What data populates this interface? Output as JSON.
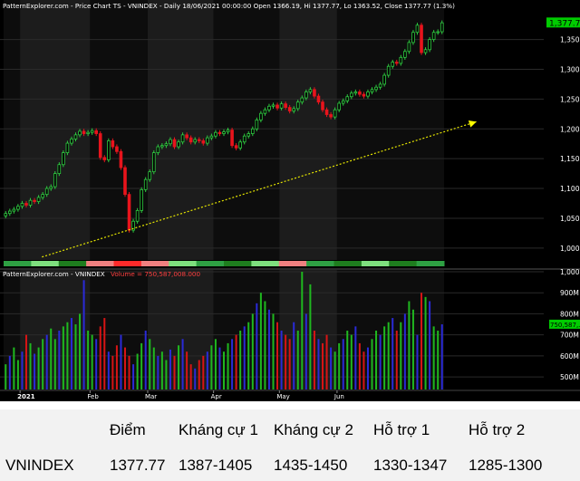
{
  "chart_data": [
    {
      "type": "candlestick",
      "header": "PatternExplorer.com - Price Chart TS - VNINDEX - Daily 18/06/2021 00:00:00 Open 1366.19, Hi 1377.77, Lo 1363.52, Close 1377.77 (1.3%)",
      "symbol": "VNINDEX",
      "last": {
        "open": 1366.19,
        "high": 1377.77,
        "low": 1363.52,
        "close": 1377.77,
        "change_pct": 1.3
      },
      "price_badge": "1,377.77",
      "ylim": [
        980,
        1395
      ],
      "yticks": [
        1000,
        1050,
        1100,
        1150,
        1200,
        1250,
        1300,
        1350
      ],
      "ytick_labels": [
        "1,000",
        "1,050",
        "1,100",
        "1,150",
        "1,200",
        "1,250",
        "1,300",
        "1,350"
      ],
      "closes": [
        1058,
        1062,
        1065,
        1070,
        1075,
        1072,
        1080,
        1078,
        1085,
        1090,
        1100,
        1103,
        1125,
        1140,
        1160,
        1176,
        1183,
        1190,
        1196,
        1192,
        1194,
        1197,
        1192,
        1152,
        1148,
        1180,
        1170,
        1162,
        1135,
        1090,
        1030,
        1045,
        1063,
        1098,
        1115,
        1128,
        1160,
        1170,
        1172,
        1175,
        1182,
        1170,
        1178,
        1190,
        1185,
        1178,
        1182,
        1180,
        1176,
        1185,
        1188,
        1194,
        1192,
        1195,
        1198,
        1172,
        1168,
        1178,
        1188,
        1192,
        1200,
        1215,
        1226,
        1232,
        1238,
        1240,
        1235,
        1242,
        1236,
        1230,
        1234,
        1245,
        1252,
        1262,
        1266,
        1255,
        1245,
        1232,
        1224,
        1220,
        1232,
        1243,
        1247,
        1254,
        1260,
        1262,
        1258,
        1255,
        1262,
        1266,
        1270,
        1275,
        1290,
        1305,
        1312,
        1310,
        1320,
        1330,
        1345,
        1362,
        1374,
        1328,
        1333,
        1350,
        1362,
        1363,
        1378
      ],
      "trendline": {
        "start": [
          0,
          985
        ],
        "end": [
          106,
          1212
        ]
      },
      "bottom_strip_colors": [
        "#2ea043",
        "#7ee07e",
        "#1e7d1e",
        "#f08080",
        "#ff2a2a",
        "#f08080",
        "#7ee07e",
        "#2ea043",
        "#1e7d1e",
        "#7ee07e",
        "#f08080",
        "#2ea043",
        "#1e7d1e",
        "#7ee07e",
        "#1e7d1e",
        "#2ea043"
      ]
    },
    {
      "type": "bar",
      "header": "PatternExplorer.com - VNINDEX",
      "header_value": "Volume = 750,587,008.000",
      "volume_badge": "750,587,...",
      "ylim": [
        440,
        1000
      ],
      "yticks": [
        500,
        600,
        700,
        800,
        900,
        1000
      ],
      "ytick_labels": [
        "500M",
        "600M",
        "700M",
        "800M",
        "900M",
        "1,000M"
      ],
      "values": [
        560,
        600,
        640,
        580,
        620,
        700,
        660,
        610,
        640,
        680,
        700,
        730,
        680,
        720,
        740,
        760,
        780,
        750,
        800,
        960,
        720,
        700,
        680,
        740,
        780,
        620,
        600,
        650,
        700,
        640,
        600,
        560,
        610,
        660,
        720,
        680,
        640,
        600,
        620,
        580,
        630,
        600,
        650,
        680,
        620,
        560,
        540,
        580,
        600,
        620,
        650,
        680,
        640,
        620,
        660,
        680,
        700,
        720,
        740,
        760,
        800,
        850,
        900,
        860,
        820,
        800,
        760,
        720,
        700,
        680,
        760,
        720,
        1000,
        800,
        940,
        720,
        680,
        660,
        700,
        640,
        620,
        660,
        680,
        720,
        700,
        740,
        660,
        620,
        640,
        680,
        720,
        700,
        740,
        760,
        780,
        720,
        760,
        800,
        860,
        820,
        700,
        900,
        880,
        860,
        740,
        720,
        750
      ],
      "x_labels": [
        "2021",
        "Feb",
        "Mar",
        "Apr",
        "May",
        "Jun"
      ],
      "x_label_index": [
        4,
        21,
        35,
        51,
        67,
        81
      ]
    }
  ],
  "table": {
    "headers": [
      "",
      "Điểm",
      "Kháng cự 1",
      "Kháng cự 2",
      "Hỗ trợ 1",
      "Hỗ trợ 2"
    ],
    "row": [
      "VNINDEX",
      "1377.77",
      "1387-1405",
      "1435-1450",
      "1330-1347",
      "1285-1300"
    ]
  }
}
